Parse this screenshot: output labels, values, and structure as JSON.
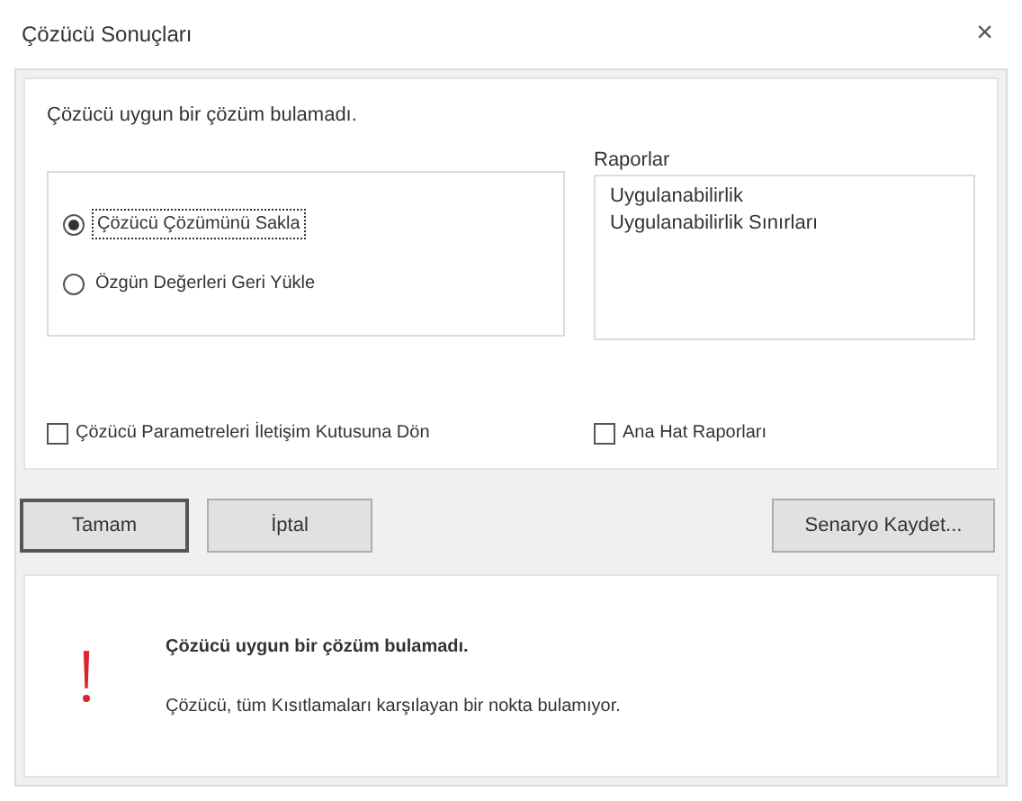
{
  "window": {
    "title": "Çözücü Sonuçları",
    "close": "×"
  },
  "message": "Çözücü uygun bir çözüm bulamadı.",
  "options": [
    {
      "label": "Çözücü Çözümünü Sakla",
      "selected": true
    },
    {
      "label": "Özgün Değerleri Geri Yükle",
      "selected": false
    }
  ],
  "reports": {
    "label": "Raporlar",
    "items": [
      "Uygulanabilirlik",
      "Uygulanabilirlik Sınırları"
    ]
  },
  "checkboxes": [
    {
      "label": "Çözücü Parametreleri İletişim Kutusuna Dön",
      "checked": false
    },
    {
      "label": "Ana Hat Raporları",
      "checked": false
    }
  ],
  "buttons": [
    {
      "label": "Tamam",
      "default": true
    },
    {
      "label": "İptal",
      "default": false
    },
    {
      "label": "Senaryo Kaydet...",
      "default": false
    }
  ],
  "info": {
    "title": "Çözücü uygun bir çözüm bulamadı.",
    "body": "Çözücü, tüm Kısıtlamaları karşılayan bir nokta bulamıyor."
  }
}
